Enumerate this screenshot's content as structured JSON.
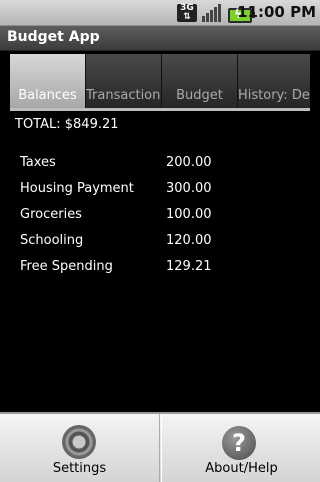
{
  "status_bar": {
    "network": "3G",
    "time": "11:00 PM"
  },
  "app": {
    "title": "Budget App"
  },
  "tabs": [
    {
      "label": "Balances",
      "active": true
    },
    {
      "label": "Transactions",
      "active": false
    },
    {
      "label": "Budget",
      "active": false
    },
    {
      "label": "History: Dec",
      "active": false
    }
  ],
  "balances": {
    "total_label": "TOTAL: $849.21",
    "items": [
      {
        "name": "Taxes",
        "amount": "200.00"
      },
      {
        "name": "Housing Payment",
        "amount": "300.00"
      },
      {
        "name": "Groceries",
        "amount": "100.00"
      },
      {
        "name": "Schooling",
        "amount": "120.00"
      },
      {
        "name": "Free Spending",
        "amount": "129.21"
      }
    ]
  },
  "menu": {
    "settings": {
      "label": "Settings",
      "icon": "settings-gear-icon"
    },
    "about": {
      "label": "About/Help",
      "icon": "help-question-icon"
    }
  },
  "colors": {
    "background": "#000000",
    "tab_active": "#bdbdbd",
    "battery": "#7ad12b"
  }
}
